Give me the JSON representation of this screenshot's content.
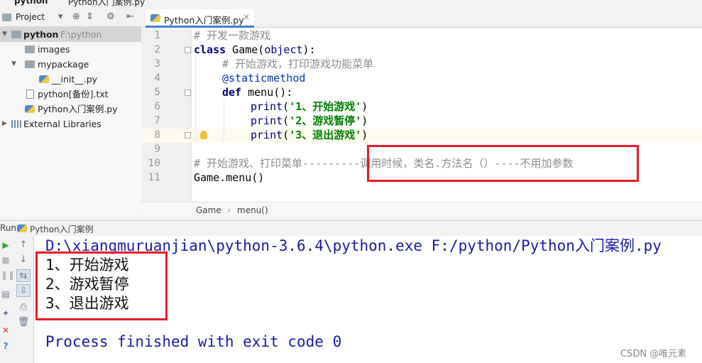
{
  "breadcrumbs": [
    "python",
    "Python入门案例.py"
  ],
  "project_panel": {
    "title": "Project",
    "tree": [
      {
        "label": "python",
        "hint": "F:\\python",
        "kind": "folder",
        "level": 0,
        "selected": true,
        "expanded": true
      },
      {
        "label": "images",
        "kind": "folder",
        "level": 1
      },
      {
        "label": "mypackage",
        "kind": "folder",
        "level": 1,
        "expanded": true
      },
      {
        "label": "__init__.py",
        "kind": "pyfile",
        "level": 2
      },
      {
        "label": "python[备份].txt",
        "kind": "txtfile",
        "level": 1
      },
      {
        "label": "Python入门案例.py",
        "kind": "pyfile",
        "level": 1
      },
      {
        "label": "External Libraries",
        "kind": "lib",
        "level": 0
      }
    ]
  },
  "editor": {
    "tab_label": "Python入门案例.py",
    "tab_close": "×",
    "line_numbers": [
      "1",
      "2",
      "3",
      "4",
      "5",
      "6",
      "7",
      "8",
      "9",
      "10",
      "11"
    ],
    "lines": {
      "l1": "# 开发一款游戏",
      "l2_kw": "class",
      "l2_rest": " Game(",
      "l2_base": "object",
      "l2_end": "):",
      "l3": "# 开始游戏，打印游戏功能菜单",
      "l4": "@staticmethod",
      "l5_kw": "def",
      "l5_rest": " menu():",
      "l6_fn": "print",
      "l6_str": "'1、开始游戏'",
      "l7_fn": "print",
      "l7_str": "'2、游戏暂停'",
      "l8_fn": "print",
      "l8_str": "'3、退出游戏'",
      "l10": "# 开始游戏、打印菜单---------调用时候，类名.方法名（）----不用加参数",
      "l11": "Game.menu()"
    },
    "crumb": [
      "Game",
      "menu()"
    ],
    "crumb_sep": "›"
  },
  "run_panel": {
    "title": "Run",
    "config": "Python入门案例",
    "console": {
      "command": "D:\\xiangmuruanjian\\python-3.6.4\\python.exe F:/python/Python入门案例.py",
      "output": [
        "1、开始游戏",
        "2、游戏暂停",
        "3、退出游戏"
      ],
      "exit": "Process finished with exit code 0"
    }
  },
  "watermark": "CSDN @唯元素",
  "colors": {
    "keyword": "#000080",
    "string": "#008000",
    "comment": "#8c8c8c",
    "annotation_box": "#e8192c",
    "console_text": "#1a1aa6"
  }
}
